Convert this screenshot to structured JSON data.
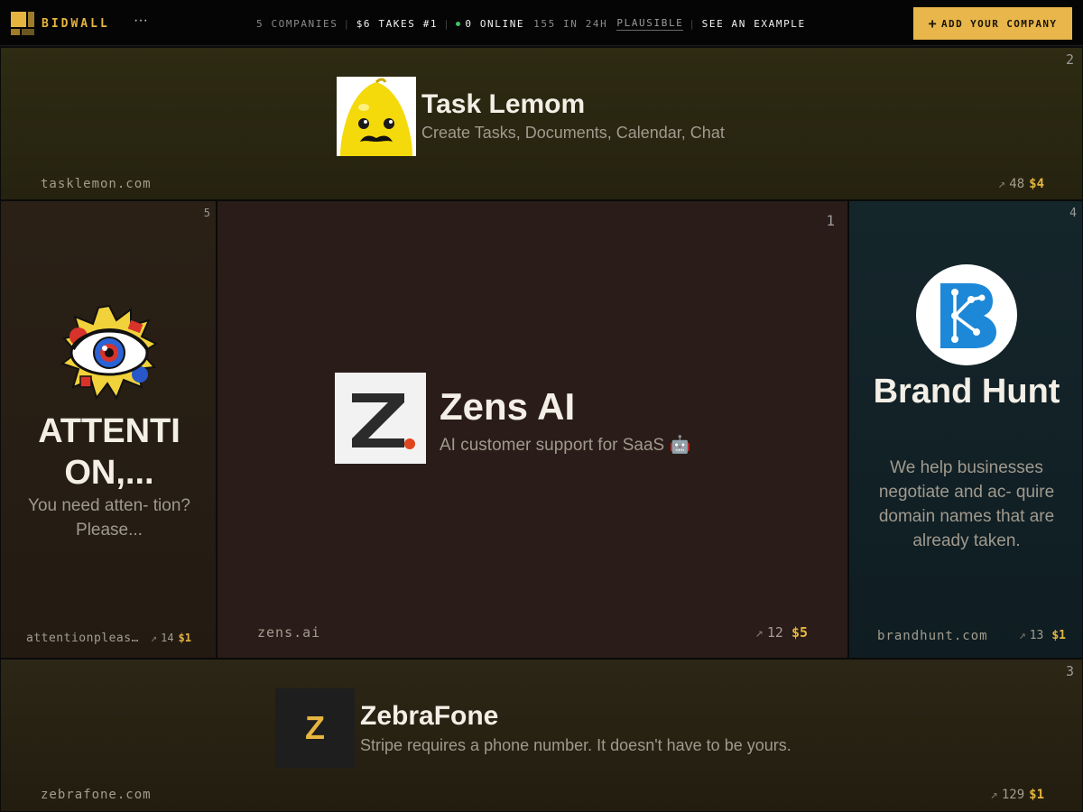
{
  "header": {
    "brand": "BIDWALL",
    "more": "···",
    "stats": {
      "companies": "5 COMPANIES",
      "top_takes": "$6 TAKES #1",
      "online": "0 ONLINE",
      "visits": "155 IN 24H",
      "analytics": "PLAUSIBLE",
      "example": "SEE AN EXAMPLE"
    },
    "add_button": "ADD YOUR COMPANY",
    "add_icon": "+",
    "colors": {
      "accent": "#e8b64a",
      "online_dot": "#3fbf6a"
    }
  },
  "tiles": {
    "lemon": {
      "rank": "2",
      "title": "Task Lemom",
      "description": "Create Tasks, Documents, Calendar, Chat",
      "domain": "tasklemon.com",
      "arrow": "↗",
      "clicks": "48",
      "price": "$4"
    },
    "attention": {
      "rank": "5",
      "title": "ATTENTI ON,...",
      "description": "You need atten- tion? Please...",
      "domain": "attentionpleas…",
      "arrow": "↗",
      "clicks": "14",
      "price": "$1"
    },
    "zens": {
      "rank": "1",
      "logo_letter": "Z.",
      "title": "Zens AI",
      "description": "AI customer support for SaaS 🤖",
      "domain": "zens.ai",
      "arrow": "↗",
      "clicks": "12",
      "price": "$5"
    },
    "brandhunt": {
      "rank": "4",
      "title": "Brand Hunt",
      "description": "We help businesses negotiate and ac- quire domain names that are already taken.",
      "domain": "brandhunt.com",
      "arrow": "↗",
      "clicks": "13",
      "price": "$1"
    },
    "zebra": {
      "rank": "3",
      "logo_letter": "Z",
      "title": "ZebraFone",
      "description": "Stripe requires a phone number. It doesn't have to be yours.",
      "domain": "zebrafone.com",
      "arrow": "↗",
      "clicks": "129",
      "price": "$1"
    }
  }
}
